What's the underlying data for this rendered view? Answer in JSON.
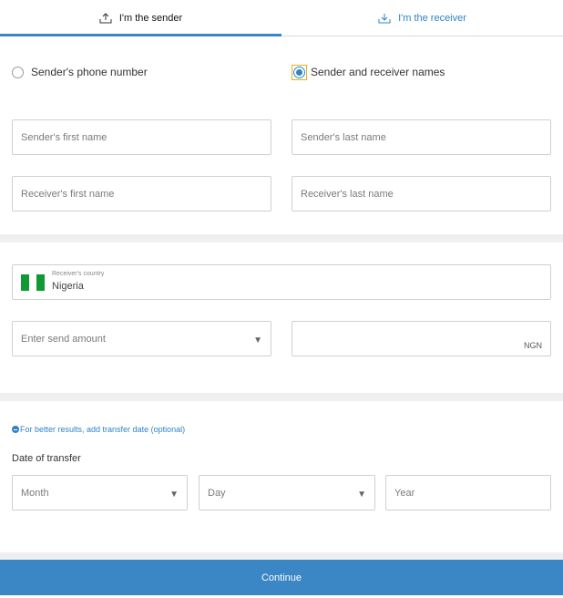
{
  "tabs": {
    "sender_label": "I'm the sender",
    "receiver_label": "I'm the receiver",
    "sender_icon": "upload-icon",
    "receiver_icon": "download-icon"
  },
  "lookup_method": {
    "phone_label": "Sender's phone number",
    "names_label": "Sender and receiver names",
    "selected": "names"
  },
  "names": {
    "sender_first_placeholder": "Sender's first name",
    "sender_last_placeholder": "Sender's last name",
    "receiver_first_placeholder": "Receiver's first name",
    "receiver_last_placeholder": "Receiver's last name"
  },
  "country": {
    "label": "Receiver's country",
    "value": "Nigeria",
    "flag_colors": [
      "#119933",
      "#ffffff",
      "#119933"
    ]
  },
  "amount": {
    "send_placeholder": "Enter send amount",
    "receive_currency": "NGN"
  },
  "date": {
    "toggle_label": "For better results, add transfer date (optional)",
    "section_label": "Date of transfer",
    "month_placeholder": "Month",
    "day_placeholder": "Day",
    "year_placeholder": "Year"
  },
  "actions": {
    "continue_label": "Continue"
  },
  "colors": {
    "accent": "#3b86c4",
    "link": "#2e84c6",
    "band": "#efefef"
  }
}
